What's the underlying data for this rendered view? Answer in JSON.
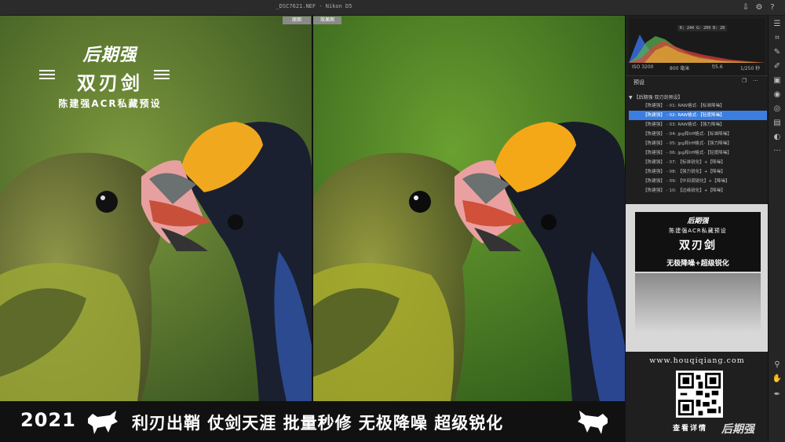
{
  "titlebar": {
    "file": "_DSC7621.NEF  -  Nikon D5",
    "icons": [
      "export-icon",
      "gear-icon",
      "help-icon"
    ]
  },
  "viewer": {
    "left_label": "原图",
    "right_label": "效果图"
  },
  "brand": {
    "logo": "后期强",
    "name": "双刃剑",
    "sub": "陈建强ACR私藏预设"
  },
  "banner": {
    "year": "2021",
    "slogans": "利刃出鞘  仗剑天涯  批量秒修  无极降噪  超级锐化",
    "icons": [
      "bull-icon",
      "bull-icon"
    ]
  },
  "histogram": {
    "rgb_readout": "R: 244   G: 209   B: 28",
    "colors": {
      "red": "#e0403a",
      "green": "#58b050",
      "blue": "#3a6ee0",
      "yellow": "#e8c030"
    }
  },
  "camera": {
    "iso": "ISO 3200",
    "focal": "800 毫米",
    "aperture": "f/5.6",
    "shutter": "1/250 秒"
  },
  "presets": {
    "title": "预设",
    "group": "【后期强·双刃剑预设】",
    "items": [
      "【陈建强】 - 01: RAW格式-【标准降噪】",
      "【陈建强】 - 02: RAW格式-【轻度降噪】",
      "【陈建强】 - 03: RAW格式-【强力降噪】",
      "【陈建强】 - 04: jpg和tiff格式-【标准降噪】",
      "【陈建强】 - 05: jpg和tiff格式-【强力降噪】",
      "【陈建强】 - 06: jpg和tiff格式-【轻度降噪】",
      "【陈建强】 - 07: 【标准锐化】+【降噪】",
      "【陈建强】 - 08: 【强力锐化】+【降噪】",
      "【陈建强】 - 09: 【中间调锐化】+【降噪】",
      "【陈建强】 - 10: 【边缘锐化】+【降噪】"
    ],
    "selected_index": 1,
    "accent": "#3b7ee0"
  },
  "promo": {
    "logo": "后期强",
    "sub": "陈建强ACR私藏预设",
    "name": "双刃剑",
    "tagline": "无极降噪+超级锐化",
    "website": "www.houqiqiang.com",
    "qr_caption": "查看详情",
    "watermark": "后期强"
  },
  "tools": [
    "sliders-icon",
    "crop-icon",
    "healing-icon",
    "brush-icon",
    "gradient-icon",
    "radial-icon",
    "redeye-icon",
    "snapshot-icon",
    "presets-icon",
    "more-icon",
    "zoom-icon",
    "hand-icon",
    "eyedropper-icon"
  ]
}
